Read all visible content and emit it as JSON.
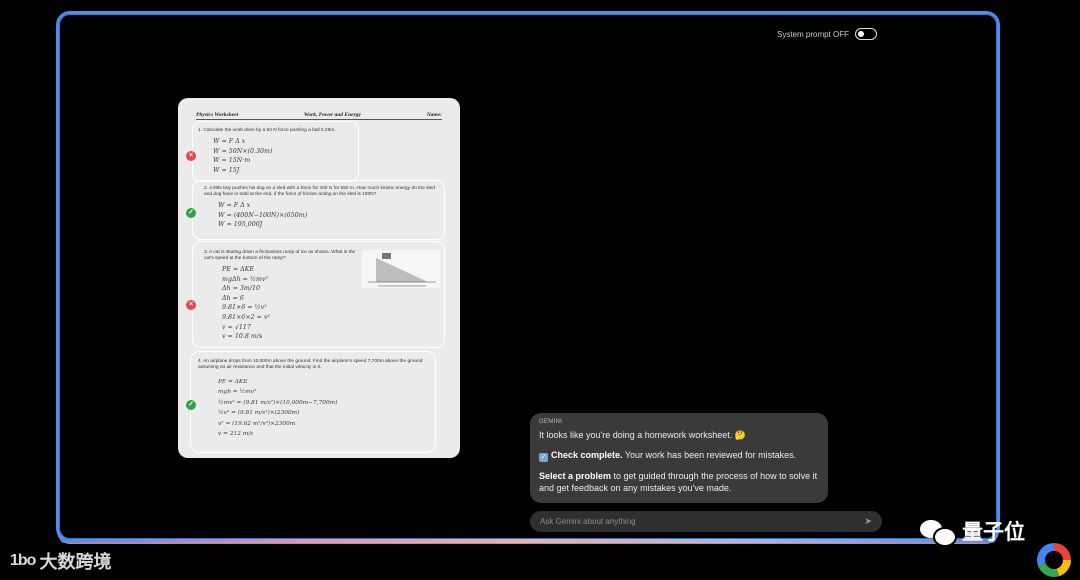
{
  "system_prompt": {
    "label": "System prompt OFF",
    "state": "off"
  },
  "worksheet": {
    "header": {
      "title": "Physics Worksheet",
      "topic": "Work, Power and Energy",
      "name_label": "Name:"
    },
    "questions": [
      {
        "text": "1. Calculate the work done by a 50 N force pushing a ball 0.26m.",
        "work": "W = F Δ x\nW = 50N×(0.30m)\nW = 15N·m\nW = 15J",
        "status": "incorrect"
      },
      {
        "text": "2. A little boy pushes his dog on a sled with a force for 400 N for 650 m. How much kinetic energy do the sled and dog have in total at the end, if the force of friction acting on the sled is 100N?",
        "work": "W = F Δ x\nW = (400N−100N)×(650m)\nW = 195,000J",
        "status": "correct"
      },
      {
        "text": "3. A cat is skating down a frictionless ramp of ice as shown. What is the cat's speed at the bottom of the ramp?",
        "work": "PE = ΔKE\nmgΔh = ½mv²\nΔh = 3m/10\nΔh = 6\n9.81×6 = ½v²\n9.81×6×2 = v²\nv = √117\nv = 10.8 m/s",
        "status": "incorrect"
      },
      {
        "text": "4. An airplane drops from 10,000m above the ground. Find the airplane's speed 7,700m above the ground assuming no air resistance and that the initial velocity is 0.",
        "work": "PE = ΔKE\nmgh = ½mv²\n½mv² = (9.81 m/s²)×(10,000m−7,700m)\n½v² = (9.81 m/s²)×(2300m)\nv² = (19.62 m²/s²)×2300m\nv = 212 m/s",
        "status": "correct"
      }
    ]
  },
  "gemini": {
    "label": "GEMINI",
    "line1": "It looks like you're doing a homework worksheet. 🤔",
    "check_bold": "Check complete.",
    "check_rest": " Your work has been reviewed for mistakes.",
    "select_bold": "Select a problem",
    "select_rest": " to get guided through the process of how to solve it and get feedback on any mistakes you've made."
  },
  "ask": {
    "placeholder": "Ask Gemini about anything",
    "send_icon": "send-icon"
  },
  "watermarks": {
    "left": "大数跨境",
    "left_mark": "1bo",
    "right": "量子位"
  },
  "colors": {
    "frame": "#4d8ee8",
    "incorrect": "#e5484d",
    "correct": "#2fa24b",
    "bubble": "#3a3a3a"
  }
}
